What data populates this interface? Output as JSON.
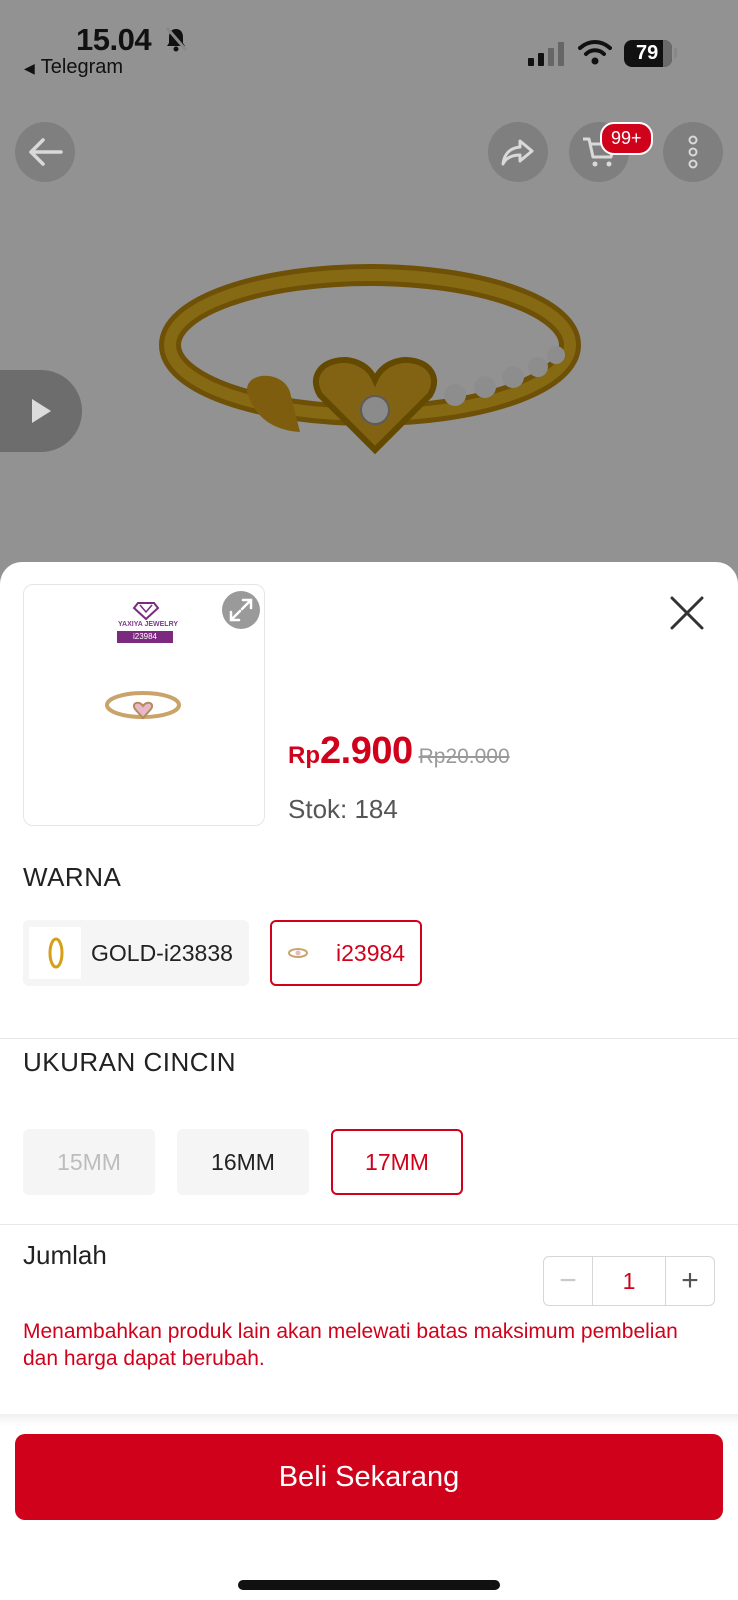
{
  "status_bar": {
    "time": "15.04",
    "back_app": "Telegram",
    "battery": "79"
  },
  "product_header": {
    "cart_badge": "99+"
  },
  "sheet": {
    "thumbnail": {
      "brand_name": "YAXIYA JEWELRY",
      "product_code": "i23984"
    },
    "price_currency": "Rp",
    "price": "2.900",
    "original_price": "Rp20.000",
    "stock_label": "Stok: 184",
    "color_section": {
      "title": "WARNA",
      "options": [
        {
          "label": "GOLD-i23838",
          "state": "normal"
        },
        {
          "label": "i23984",
          "state": "selected"
        }
      ]
    },
    "size_section": {
      "title": "UKURAN CINCIN",
      "options": [
        {
          "label": "15MM",
          "state": "disabled"
        },
        {
          "label": "16MM",
          "state": "normal"
        },
        {
          "label": "17MM",
          "state": "selected"
        }
      ]
    },
    "quantity": {
      "label": "Jumlah",
      "value": "1",
      "minus": "−",
      "plus": "+"
    },
    "warning": "Menambahkan produk lain akan melewati batas maksimum pembelian dan harga dapat berubah.",
    "buy_button": "Beli Sekarang"
  },
  "colors": {
    "accent": "#d0021b",
    "overlay": "rgba(0,0,0,0.40)"
  }
}
